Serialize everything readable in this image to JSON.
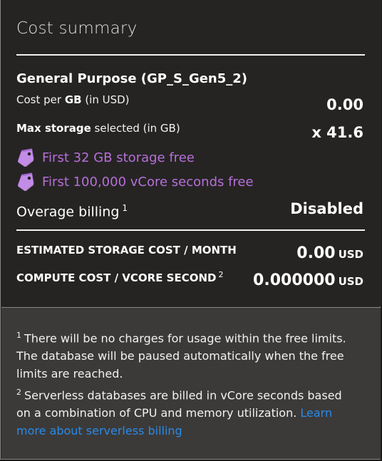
{
  "title": "Cost summary",
  "tier": "General Purpose (GP_S_Gen5_2)",
  "cost_per_gb": {
    "prefix": "Cost per ",
    "bold": "GB",
    "suffix": " (in USD)",
    "value": "0.00"
  },
  "max_storage": {
    "bold": "Max storage",
    "suffix": " selected (in GB)",
    "value": "x 41.6"
  },
  "free_items": [
    {
      "icon": "price-tag-icon",
      "label": "First 32 GB storage free"
    },
    {
      "icon": "price-tag-icon",
      "label": "First 100,000 vCore seconds free"
    }
  ],
  "overage": {
    "label": "Overage billing",
    "sup": "1",
    "value": "Disabled"
  },
  "estimated_storage": {
    "label": "ESTIMATED STORAGE COST / MONTH",
    "value": "0.00",
    "unit": "USD"
  },
  "compute_cost": {
    "label": "COMPUTE COST / VCORE SECOND",
    "sup": "2",
    "value": "0.000000",
    "unit": "USD"
  },
  "notes": {
    "note1_sup": "1",
    "note1_text": "There will be no charges for usage within the free limits. The database will be paused automatically when the free limits are reached.",
    "note2_sup": "2",
    "note2_text": "Serverless databases are billed in vCore seconds based on a combination of CPU and memory utilization. ",
    "note2_link": "Learn more about serverless billing"
  },
  "colors": {
    "accent_purple": "#b76fd9",
    "link_blue": "#2a8ae8",
    "panel_bg": "#252423",
    "notes_bg": "#3b3a39"
  }
}
